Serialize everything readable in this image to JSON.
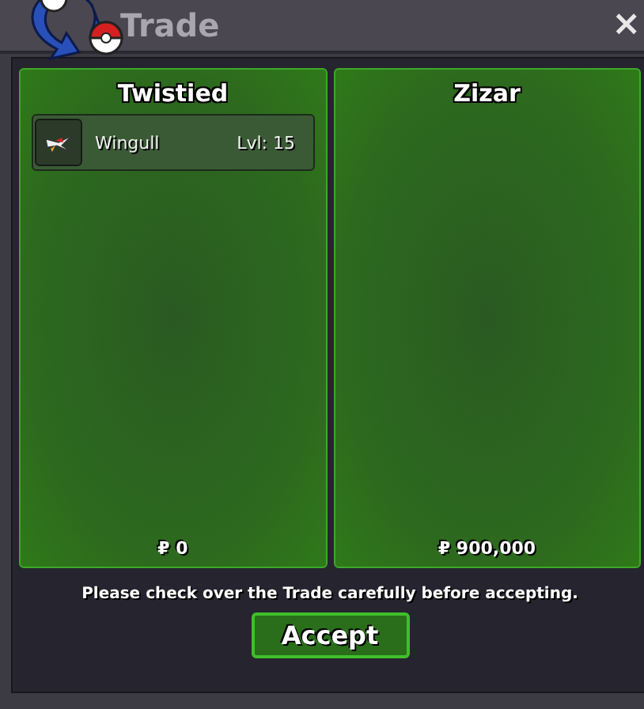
{
  "window": {
    "title": "Trade",
    "close": "×"
  },
  "traders": [
    {
      "name": "Twistied",
      "items": [
        {
          "name": "Wingull",
          "level": "Lvl: 15"
        }
      ],
      "money": "₽ 0"
    },
    {
      "name": "Zizar",
      "money": "₽ 900,000"
    }
  ],
  "notice": "Please check over the Trade carefully before accepting.",
  "buttons": [
    "Accept"
  ]
}
